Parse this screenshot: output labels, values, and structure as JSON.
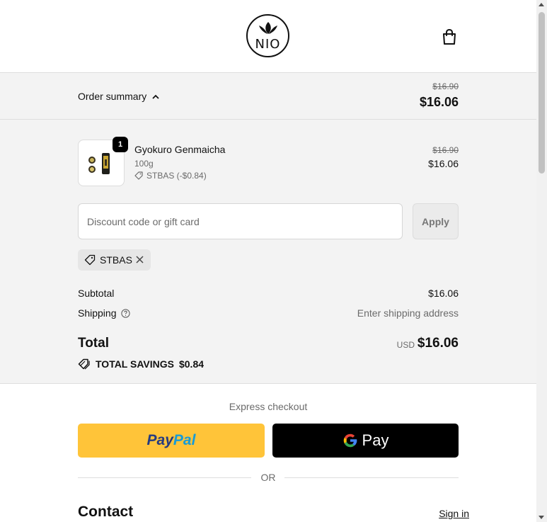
{
  "header": {
    "logo_text": "NIO",
    "cart_icon": "shopping-bag-icon"
  },
  "order_summary": {
    "toggle_label": "Order summary",
    "original_total": "$16.90",
    "discounted_total": "$16.06"
  },
  "line_item": {
    "quantity": "1",
    "name": "Gyokuro Genmaicha",
    "variant": "100g",
    "discount_note": "STBAS (-$0.84)",
    "original_price": "$16.90",
    "price": "$16.06"
  },
  "discount": {
    "placeholder": "Discount code or gift card",
    "value": "",
    "apply_label": "Apply",
    "applied_code": "STBAS"
  },
  "totals": {
    "subtotal_label": "Subtotal",
    "subtotal_value": "$16.06",
    "shipping_label": "Shipping",
    "shipping_value": "Enter shipping address",
    "total_label": "Total",
    "currency": "USD",
    "total_value": "$16.06",
    "savings_label": "TOTAL SAVINGS",
    "savings_value": "$0.84"
  },
  "express_checkout": {
    "heading": "Express checkout",
    "paypal_part1": "Pay",
    "paypal_part2": "Pal",
    "gpay_label": "Pay",
    "or_label": "OR"
  },
  "contact": {
    "heading": "Contact",
    "signin_label": "Sign in"
  },
  "colors": {
    "paypal_yellow": "#ffc439",
    "paypal_navy": "#253b80",
    "paypal_blue": "#179bd7",
    "panel_bg": "#f3f3f3"
  }
}
